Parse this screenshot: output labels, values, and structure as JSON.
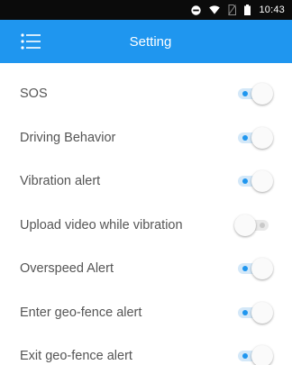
{
  "status_bar": {
    "icons": [
      "do-not-disturb-icon",
      "wifi-icon",
      "no-sim-icon",
      "battery-icon"
    ],
    "time": "10:43"
  },
  "app_bar": {
    "menu_icon": "list-menu-icon",
    "title": "Setting",
    "color": "#1f96ef"
  },
  "settings": [
    {
      "label": "SOS",
      "enabled": true
    },
    {
      "label": "Driving Behavior",
      "enabled": true
    },
    {
      "label": "Vibration alert",
      "enabled": true
    },
    {
      "label": "Upload video while vibration",
      "enabled": false
    },
    {
      "label": "Overspeed Alert",
      "enabled": true
    },
    {
      "label": "Enter geo-fence alert",
      "enabled": true
    },
    {
      "label": "Exit geo-fence alert",
      "enabled": true
    }
  ]
}
